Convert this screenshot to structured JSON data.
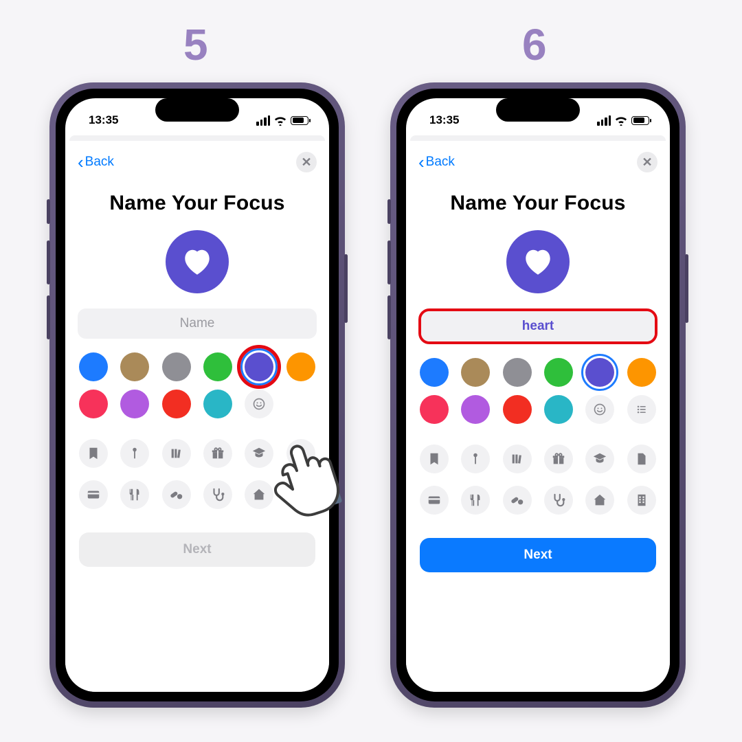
{
  "steps": {
    "five": "5",
    "six": "6"
  },
  "status": {
    "time": "13:35"
  },
  "nav": {
    "back": "Back"
  },
  "title": "Name Your Focus",
  "name_field": {
    "placeholder": "Name",
    "value": "heart"
  },
  "next_label": "Next",
  "colors": [
    {
      "name": "blue",
      "hex": "#1d7bff"
    },
    {
      "name": "brown",
      "hex": "#aa8a59"
    },
    {
      "name": "gray",
      "hex": "#8f8f95"
    },
    {
      "name": "green",
      "hex": "#2fbf3b"
    },
    {
      "name": "indigo",
      "hex": "#5a4fcf",
      "selected": true
    },
    {
      "name": "orange",
      "hex": "#fd9500"
    },
    {
      "name": "pink",
      "hex": "#f7325a"
    },
    {
      "name": "purple",
      "hex": "#b15be0"
    },
    {
      "name": "red",
      "hex": "#f22e22"
    },
    {
      "name": "teal",
      "hex": "#29b6c6"
    }
  ],
  "icon_options": [
    "bookmark",
    "pin",
    "books",
    "gift",
    "graduation",
    "document",
    "card",
    "fork-knife",
    "pills",
    "stethoscope",
    "house",
    "building"
  ],
  "selected_icon": "heart",
  "selected_color": "indigo"
}
